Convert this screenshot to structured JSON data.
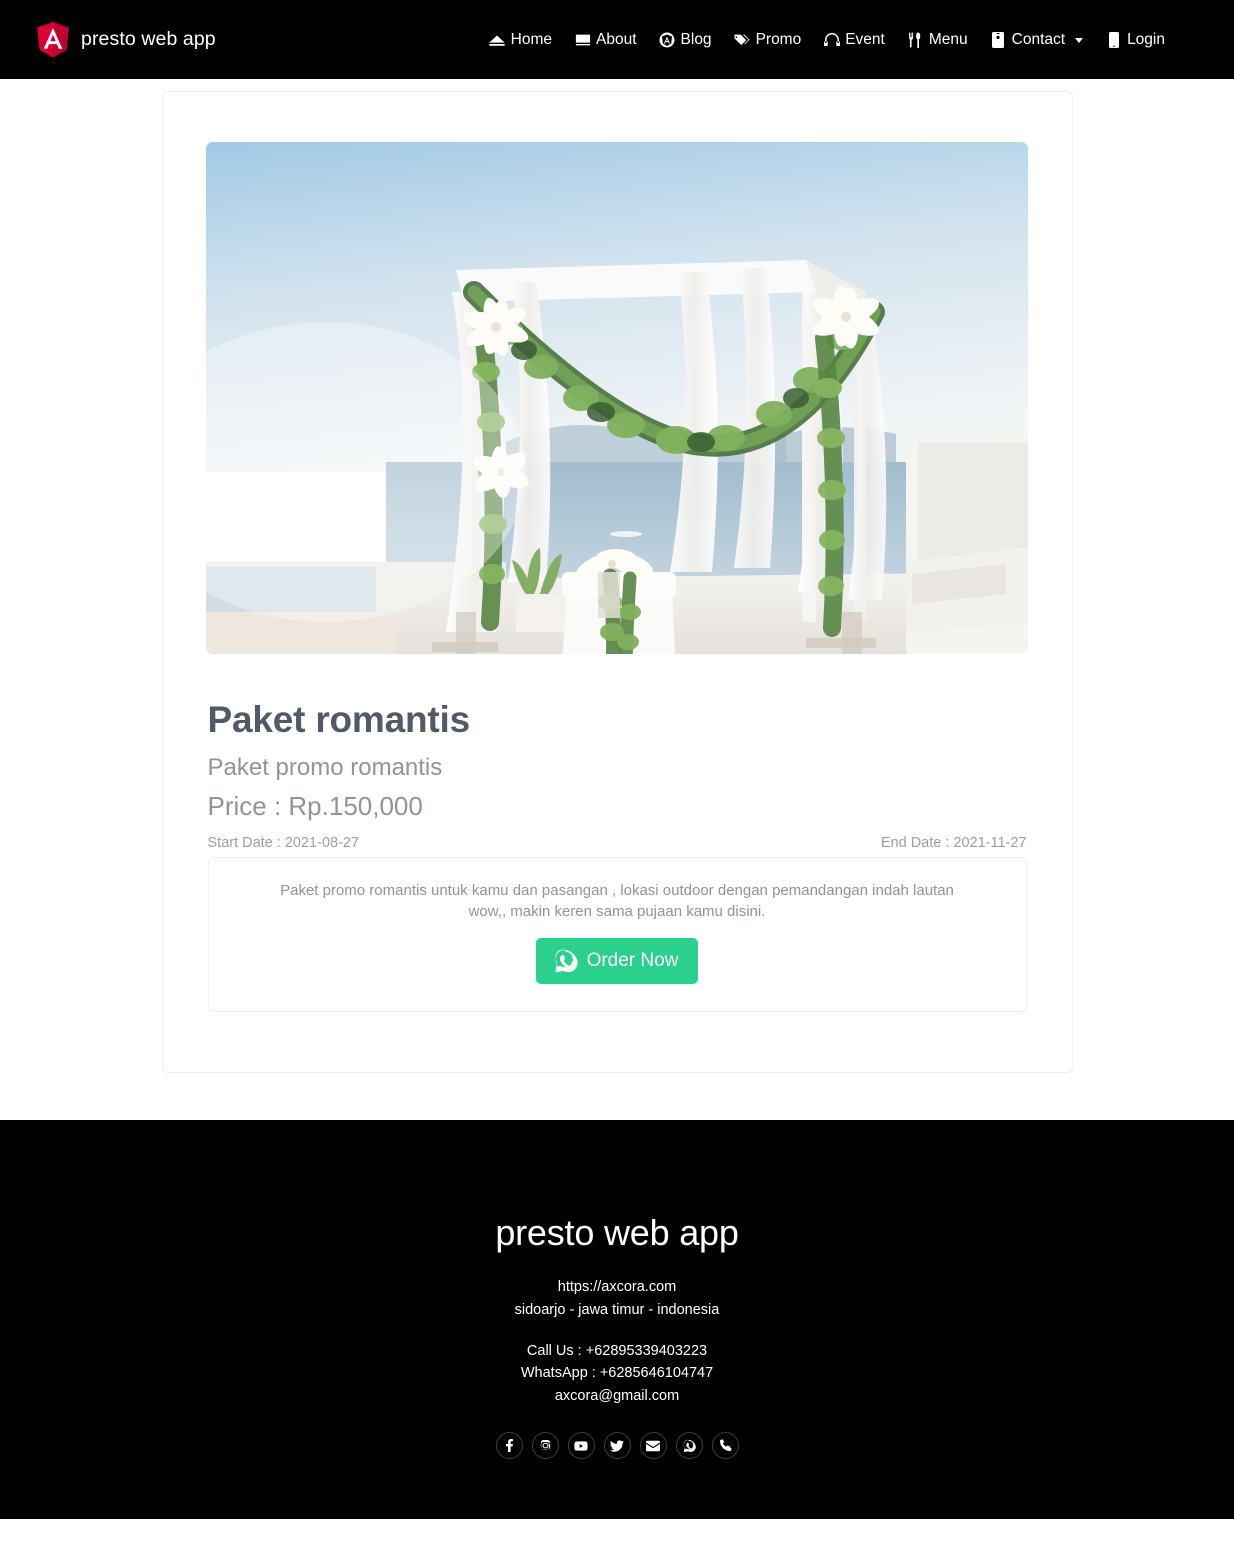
{
  "navbar": {
    "brand": {
      "label": "presto web app",
      "icon": "angular-logo-icon"
    },
    "links": [
      {
        "label": "Home",
        "icon": "eject-icon"
      },
      {
        "label": "About",
        "icon": "desktop-icon"
      },
      {
        "label": "Blog",
        "icon": "angular-circle-icon"
      },
      {
        "label": "Promo",
        "icon": "tags-icon"
      },
      {
        "label": "Event",
        "icon": "headphones-icon"
      },
      {
        "label": "Menu",
        "icon": "utensils-icon"
      },
      {
        "label": "Contact",
        "icon": "id-badge-icon",
        "has_caret": true
      },
      {
        "label": "Login",
        "icon": "mobile-icon"
      }
    ]
  },
  "promo": {
    "image_alt": "outdoor wedding arch with white drapes, green garlands and lilies overlooking the sea",
    "title": "Paket romantis",
    "subtitle": "Paket promo romantis",
    "price": "Price : Rp.150,000",
    "start_date": "Start Date : 2021-08-27",
    "end_date": "End Date : 2021-11-27",
    "description": "Paket promo romantis untuk kamu dan pasangan , lokasi outdoor dengan pemandangan indah lautan wow,, makin keren sama pujaan kamu disini.",
    "order_button": {
      "label": "Order Now",
      "icon": "whatsapp-icon",
      "color": "#2ad18d"
    }
  },
  "footer": {
    "title": "presto web app",
    "website": "https://axcora.com",
    "address": "sidoarjo - jawa timur - indonesia",
    "call": "Call Us : +62895339403223",
    "whatsapp": "WhatsApp : +6285646104747",
    "email": "axcora@gmail.com",
    "social": [
      {
        "name": "facebook-icon"
      },
      {
        "name": "instagram-icon"
      },
      {
        "name": "youtube-icon"
      },
      {
        "name": "twitter-icon"
      },
      {
        "name": "envelope-icon"
      },
      {
        "name": "whatsapp-icon"
      },
      {
        "name": "phone-icon"
      }
    ]
  },
  "colors": {
    "navbar_bg": "#000000",
    "footer_bg": "#000000",
    "brand_red": "#dd0031",
    "accent_green": "#2ad18d",
    "heading": "#525a68",
    "muted": "#8f959e"
  }
}
